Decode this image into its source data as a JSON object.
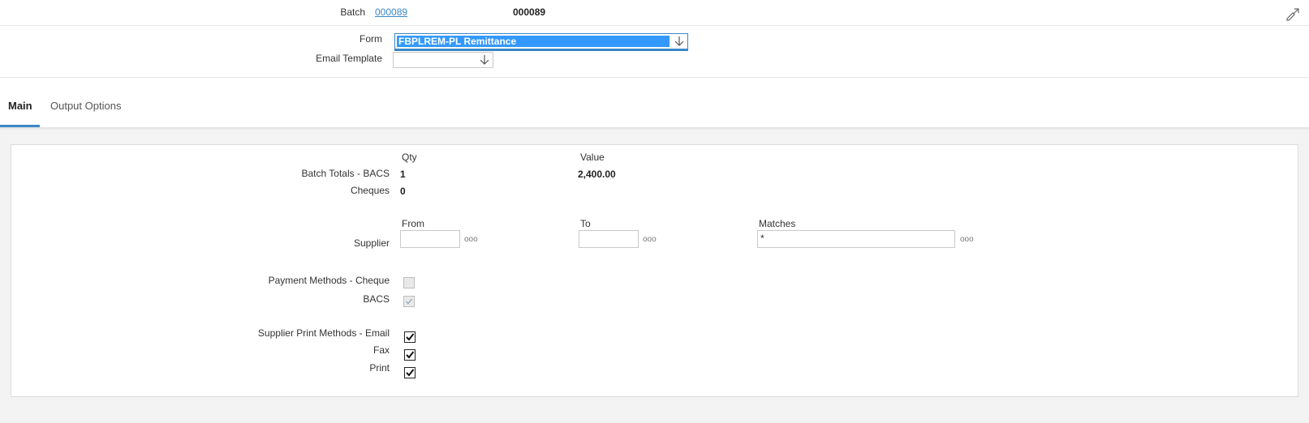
{
  "header": {
    "batch_label": "Batch",
    "batch_link": "000089",
    "batch_value": "000089",
    "form_label": "Form",
    "form_value": "FBPLREM-PL Remittance",
    "email_template_label": "Email Template",
    "email_template_value": ""
  },
  "tabs": [
    {
      "label": "Main",
      "active": true
    },
    {
      "label": "Output Options",
      "active": false
    }
  ],
  "totals": {
    "qty_header": "Qty",
    "value_header": "Value",
    "bacs_label": "Batch Totals - BACS",
    "bacs_qty": "1",
    "bacs_value": "2,400.00",
    "cheques_label": "Cheques",
    "cheques_qty": "0"
  },
  "supplier": {
    "from_header": "From",
    "to_header": "To",
    "matches_header": "Matches",
    "label": "Supplier",
    "from_value": "",
    "to_value": "",
    "matches_value": "*",
    "lookup_glyph": "ooo"
  },
  "payment_methods": {
    "cheque_label": "Payment Methods - Cheque",
    "cheque_checked": false,
    "bacs_label": "BACS",
    "bacs_checked": true
  },
  "print_methods": {
    "email_label": "Supplier Print Methods - Email",
    "email_checked": true,
    "fax_label": "Fax",
    "fax_checked": true,
    "print_label": "Print",
    "print_checked": true
  },
  "colors": {
    "accent": "#3a87c8",
    "selection": "#3399ff"
  },
  "icons": {
    "expand": "expand-edit-icon",
    "dropdown": "arrow-down-icon",
    "lookup": "ellipsis-icon"
  }
}
